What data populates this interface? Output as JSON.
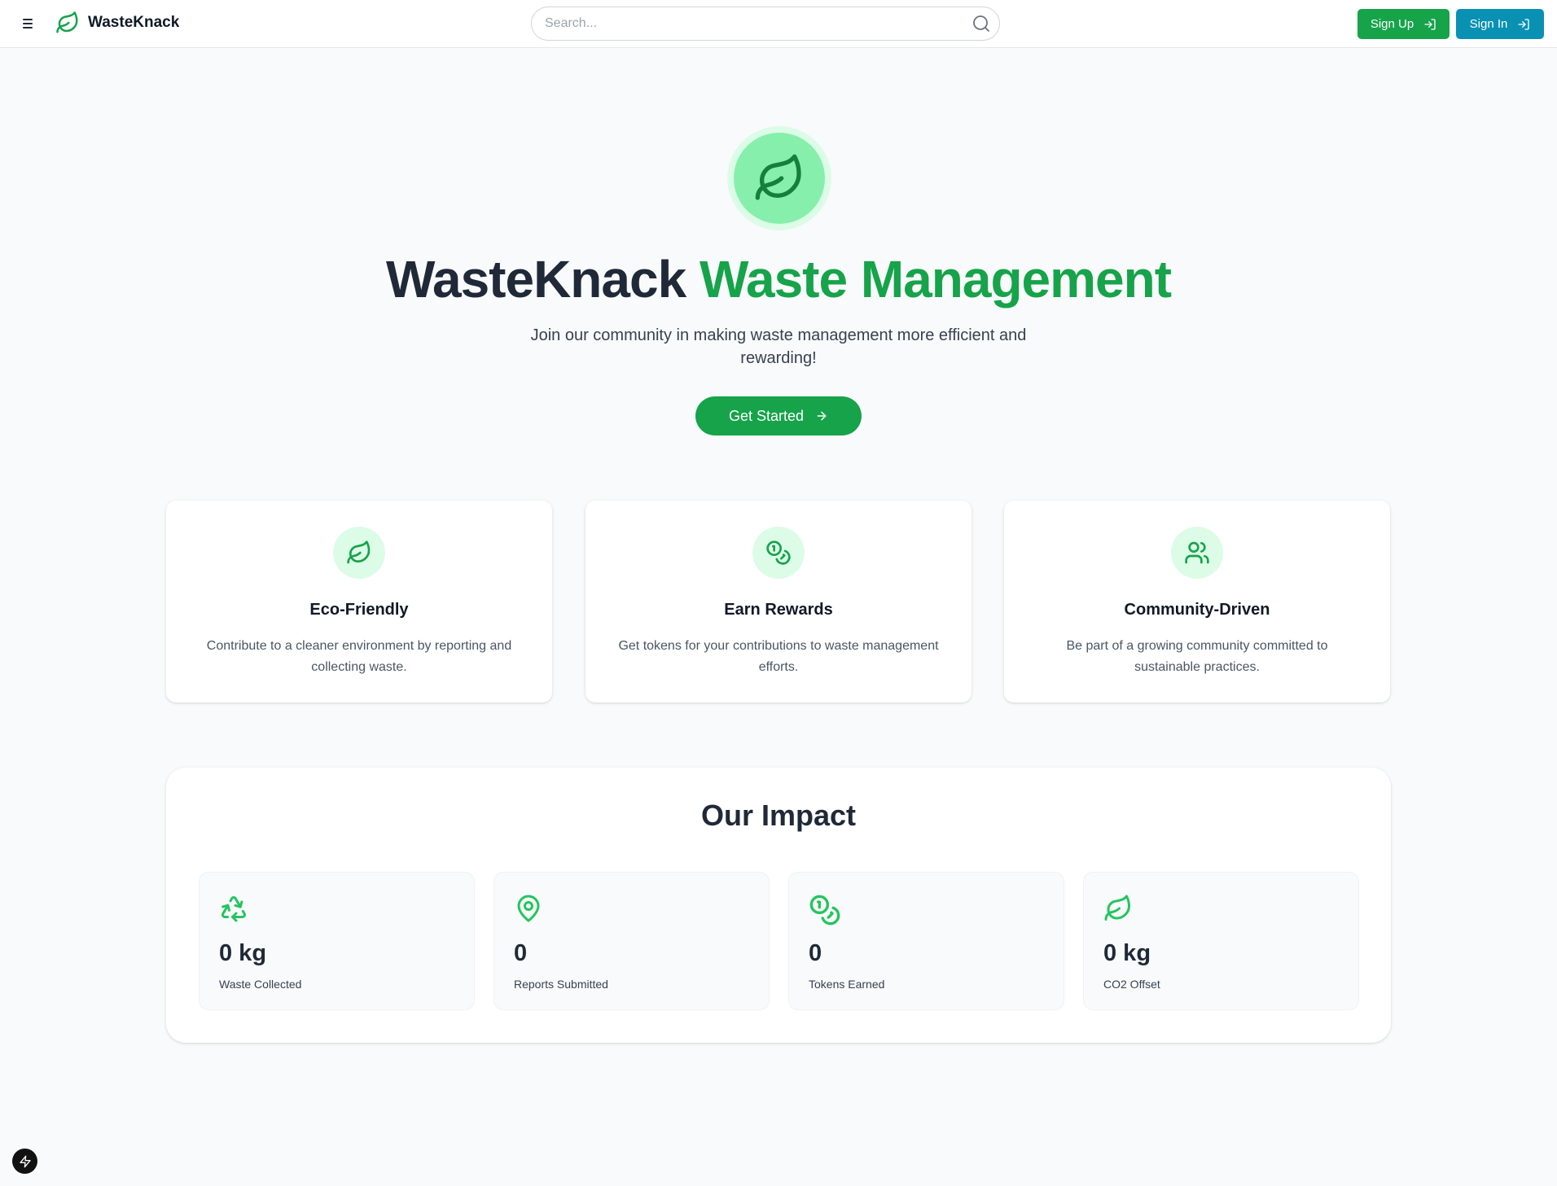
{
  "header": {
    "brand_name": "WasteKnack",
    "search_placeholder": "Search...",
    "signup_label": "Sign Up",
    "signin_label": "Sign In"
  },
  "hero": {
    "title_primary": "WasteKnack",
    "title_accent": "Waste Management",
    "subtitle": "Join our community in making waste management more efficient and rewarding!",
    "cta_label": "Get Started"
  },
  "features": [
    {
      "icon": "leaf-icon",
      "title": "Eco-Friendly",
      "description": "Contribute to a cleaner environment by reporting and collecting waste."
    },
    {
      "icon": "coins-icon",
      "title": "Earn Rewards",
      "description": "Get tokens for your contributions to waste management efforts."
    },
    {
      "icon": "users-icon",
      "title": "Community-Driven",
      "description": "Be part of a growing community committed to sustainable practices."
    }
  ],
  "impact": {
    "title": "Our Impact",
    "stats": [
      {
        "icon": "recycle-icon",
        "value": "0 kg",
        "label": "Waste Collected"
      },
      {
        "icon": "map-pin-icon",
        "value": "0",
        "label": "Reports Submitted"
      },
      {
        "icon": "coins-icon",
        "value": "0",
        "label": "Tokens Earned"
      },
      {
        "icon": "leaf-icon",
        "value": "0 kg",
        "label": "CO2 Offset"
      }
    ]
  },
  "colors": {
    "primary_green": "#16a34a",
    "signin_teal": "#0891b2",
    "light_green": "#dcfce7",
    "page_bg": "#f9fafb"
  }
}
